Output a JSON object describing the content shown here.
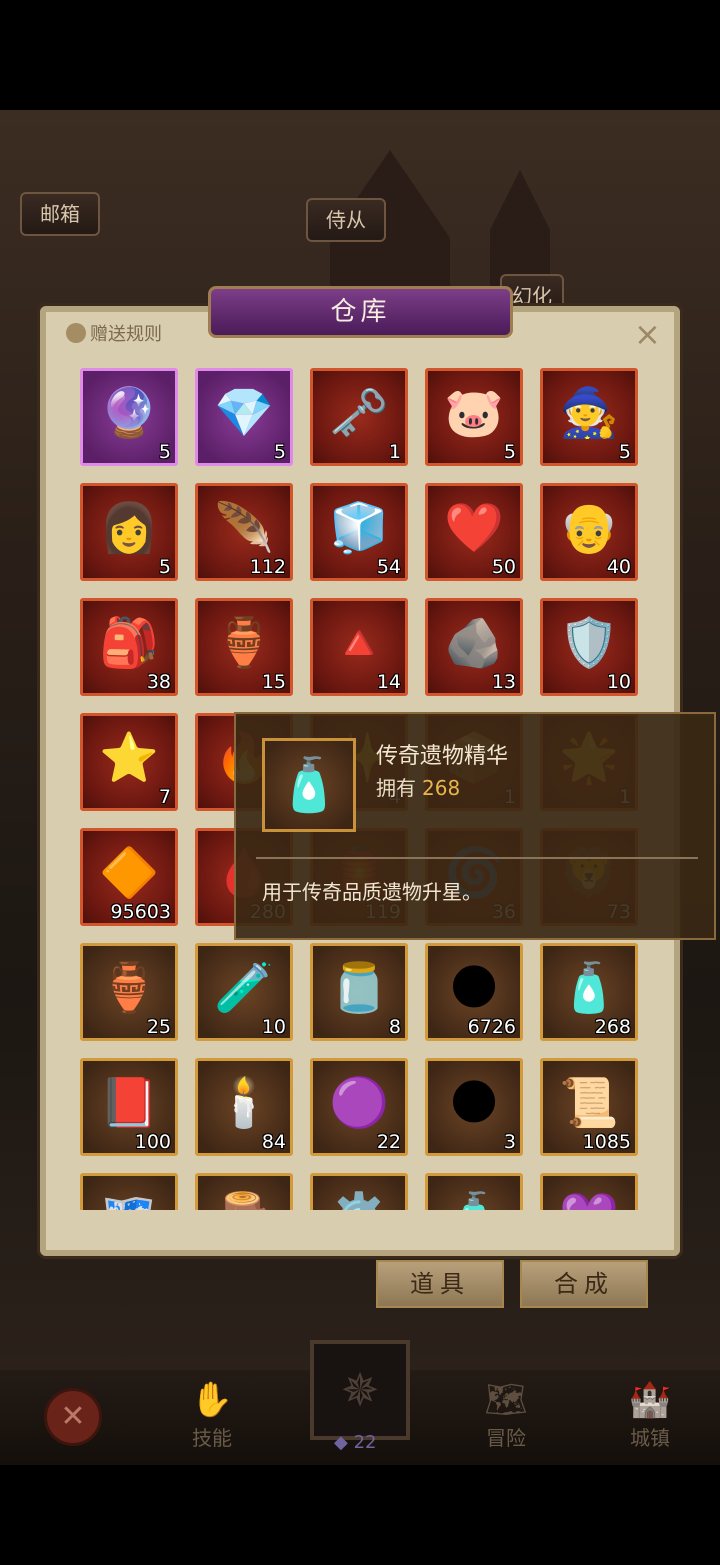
{
  "top_buttons": {
    "mailbox": "邮箱",
    "attendants": "侍从",
    "transform": "幻化"
  },
  "panel": {
    "title": "仓库",
    "gift_rules": "赠送规则",
    "close": "×"
  },
  "items": [
    {
      "icon": "🔮",
      "count": "5",
      "frame": "purple"
    },
    {
      "icon": "💎",
      "count": "5",
      "frame": "purple"
    },
    {
      "icon": "🗝️",
      "count": "1",
      "frame": "red"
    },
    {
      "icon": "🐷",
      "count": "5",
      "frame": "red"
    },
    {
      "icon": "🧙",
      "count": "5",
      "frame": "red"
    },
    {
      "icon": "👩",
      "count": "5",
      "frame": "red"
    },
    {
      "icon": "🪶",
      "count": "112",
      "frame": "red"
    },
    {
      "icon": "🧊",
      "count": "54",
      "frame": "red"
    },
    {
      "icon": "❤️",
      "count": "50",
      "frame": "red"
    },
    {
      "icon": "👴",
      "count": "40",
      "frame": "red"
    },
    {
      "icon": "🎒",
      "count": "38",
      "frame": "red"
    },
    {
      "icon": "🏺",
      "count": "15",
      "frame": "red"
    },
    {
      "icon": "🔺",
      "count": "14",
      "frame": "red"
    },
    {
      "icon": "🪨",
      "count": "13",
      "frame": "red"
    },
    {
      "icon": "🛡️",
      "count": "10",
      "frame": "red"
    },
    {
      "icon": "⭐",
      "count": "7",
      "frame": "red"
    },
    {
      "icon": "🔥",
      "count": "",
      "frame": "red"
    },
    {
      "icon": "✨",
      "count": "4",
      "frame": "red"
    },
    {
      "icon": "📦",
      "count": "1",
      "frame": "red"
    },
    {
      "icon": "🌟",
      "count": "1",
      "frame": "red"
    },
    {
      "icon": "🔶",
      "count": "95603",
      "frame": "red"
    },
    {
      "icon": "🩸",
      "count": "280",
      "frame": "red"
    },
    {
      "icon": "🏮",
      "count": "119",
      "frame": "red"
    },
    {
      "icon": "🌀",
      "count": "36",
      "frame": "red"
    },
    {
      "icon": "🦁",
      "count": "73",
      "frame": "red"
    },
    {
      "icon": "🏺",
      "count": "25",
      "frame": "gold"
    },
    {
      "icon": "🧪",
      "count": "10",
      "frame": "gold"
    },
    {
      "icon": "🫙",
      "count": "8",
      "frame": "gold"
    },
    {
      "icon": "🌑",
      "count": "6726",
      "frame": "gold"
    },
    {
      "icon": "🧴",
      "count": "268",
      "frame": "gold"
    },
    {
      "icon": "📕",
      "count": "100",
      "frame": "gold"
    },
    {
      "icon": "🕯️",
      "count": "84",
      "frame": "gold"
    },
    {
      "icon": "🟣",
      "count": "22",
      "frame": "gold"
    },
    {
      "icon": "🌑",
      "count": "3",
      "frame": "gold"
    },
    {
      "icon": "📜",
      "count": "1085",
      "frame": "gold"
    },
    {
      "icon": "🗺️",
      "count": "",
      "frame": "gold"
    },
    {
      "icon": "🪵",
      "count": "",
      "frame": "gold"
    },
    {
      "icon": "⚙️",
      "count": "",
      "frame": "gold"
    },
    {
      "icon": "🧴",
      "count": "",
      "frame": "gold"
    },
    {
      "icon": "💜",
      "count": "",
      "frame": "gold"
    }
  ],
  "tooltip": {
    "icon": "🧴",
    "name": "传奇遗物精华",
    "own_label": "拥有",
    "own_value": "268",
    "description": "用于传奇品质遗物升星。"
  },
  "tabs": {
    "items": "道具",
    "synthesis": "合成"
  },
  "bottom_nav": {
    "skills": "技能",
    "adventure": "冒险",
    "town": "城镇",
    "gem_count": "22"
  }
}
